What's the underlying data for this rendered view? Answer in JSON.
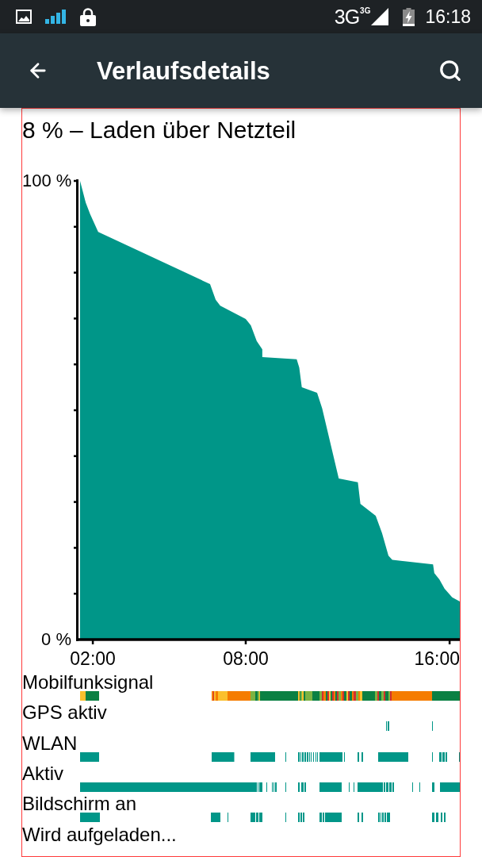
{
  "status_bar": {
    "network_type": "3G",
    "network_badge": "3G",
    "time": "16:18"
  },
  "app_bar": {
    "title": "Verlaufsdetails"
  },
  "summary": "8 % – Laden über Netzteil",
  "battery_chart": {
    "chart_data": {
      "type": "area",
      "x": [
        1.5,
        1.72,
        1.9,
        2.21,
        6.6,
        6.82,
        7.0,
        8.0,
        8.2,
        8.43,
        8.65,
        8.65,
        10.0,
        10.1,
        10.2,
        10.8,
        11.0,
        11.65,
        12.4,
        12.5,
        13.1,
        13.35,
        13.6,
        13.75,
        15.35,
        15.4,
        15.6,
        15.8,
        16.1,
        16.4
      ],
      "values": [
        100,
        95.3,
        92.7,
        88.9,
        77.5,
        74.1,
        72.8,
        69.9,
        68.5,
        65.1,
        63.3,
        61.6,
        61.1,
        59.3,
        55.0,
        53.8,
        50.4,
        35.1,
        34.3,
        29.6,
        27.0,
        23.2,
        18.3,
        17.4,
        16.4,
        14.5,
        13.1,
        11.1,
        9.2,
        8.3
      ],
      "xlim": [
        1.344,
        16.4
      ],
      "ylim": [
        0,
        100
      ],
      "xticks": [
        {
          "value": 2,
          "label": "02:00"
        },
        {
          "value": 8,
          "label": "08:00"
        },
        {
          "value": 16,
          "label": "16:00"
        }
      ],
      "yticks": [
        {
          "value": 0,
          "label": "0 %"
        },
        {
          "value": 100,
          "label": "100 %"
        }
      ]
    }
  },
  "timelines": [
    {
      "label": "Mobilfunksignal",
      "kind": "signal"
    },
    {
      "label": "GPS aktiv",
      "kind": "state"
    },
    {
      "label": "WLAN",
      "kind": "state"
    },
    {
      "label": "Aktiv",
      "kind": "state"
    },
    {
      "label": "Bildschirm an",
      "kind": "state"
    },
    {
      "label": "Wird aufgeladen...",
      "kind": "state"
    }
  ]
}
